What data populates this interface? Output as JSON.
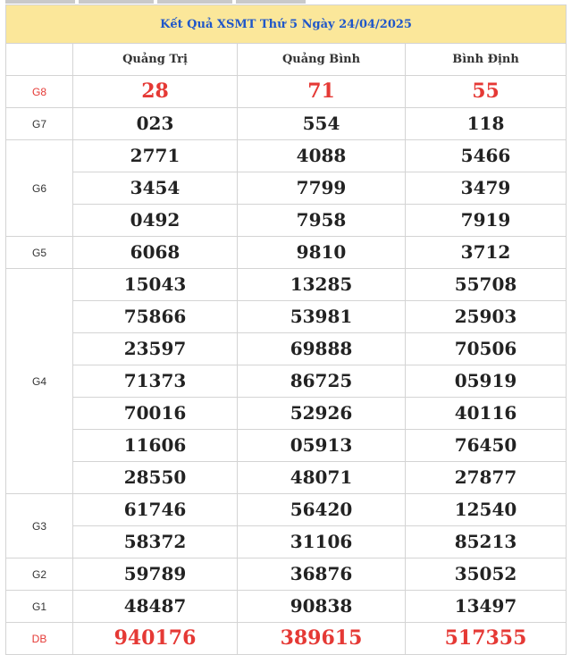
{
  "title": "Kết Quả XSMT Thứ 5 Ngày 24/04/2025",
  "provinces": [
    "Quảng Trị",
    "Quảng Bình",
    "Bình Định"
  ],
  "prizes": [
    {
      "label": "G8",
      "highlight": true,
      "rows": [
        [
          "28",
          "71",
          "55"
        ]
      ]
    },
    {
      "label": "G7",
      "highlight": false,
      "rows": [
        [
          "023",
          "554",
          "118"
        ]
      ]
    },
    {
      "label": "G6",
      "highlight": false,
      "rows": [
        [
          "2771",
          "4088",
          "5466"
        ],
        [
          "3454",
          "7799",
          "3479"
        ],
        [
          "0492",
          "7958",
          "7919"
        ]
      ]
    },
    {
      "label": "G5",
      "highlight": false,
      "rows": [
        [
          "6068",
          "9810",
          "3712"
        ]
      ]
    },
    {
      "label": "G4",
      "highlight": false,
      "rows": [
        [
          "15043",
          "13285",
          "55708"
        ],
        [
          "75866",
          "53981",
          "25903"
        ],
        [
          "23597",
          "69888",
          "70506"
        ],
        [
          "71373",
          "86725",
          "05919"
        ],
        [
          "70016",
          "52926",
          "40116"
        ],
        [
          "11606",
          "05913",
          "76450"
        ],
        [
          "28550",
          "48071",
          "27877"
        ]
      ]
    },
    {
      "label": "G3",
      "highlight": false,
      "rows": [
        [
          "61746",
          "56420",
          "12540"
        ],
        [
          "58372",
          "31106",
          "85213"
        ]
      ]
    },
    {
      "label": "G2",
      "highlight": false,
      "rows": [
        [
          "59789",
          "36876",
          "35052"
        ]
      ]
    },
    {
      "label": "G1",
      "highlight": false,
      "rows": [
        [
          "48487",
          "90838",
          "13497"
        ]
      ]
    },
    {
      "label": "DB",
      "highlight": true,
      "rows": [
        [
          "940176",
          "389615",
          "517355"
        ]
      ]
    }
  ],
  "colors": {
    "title_bg": "#fbe79a",
    "title_text": "#1f57c9",
    "highlight": "#e53935",
    "border": "#d4d4d4"
  }
}
